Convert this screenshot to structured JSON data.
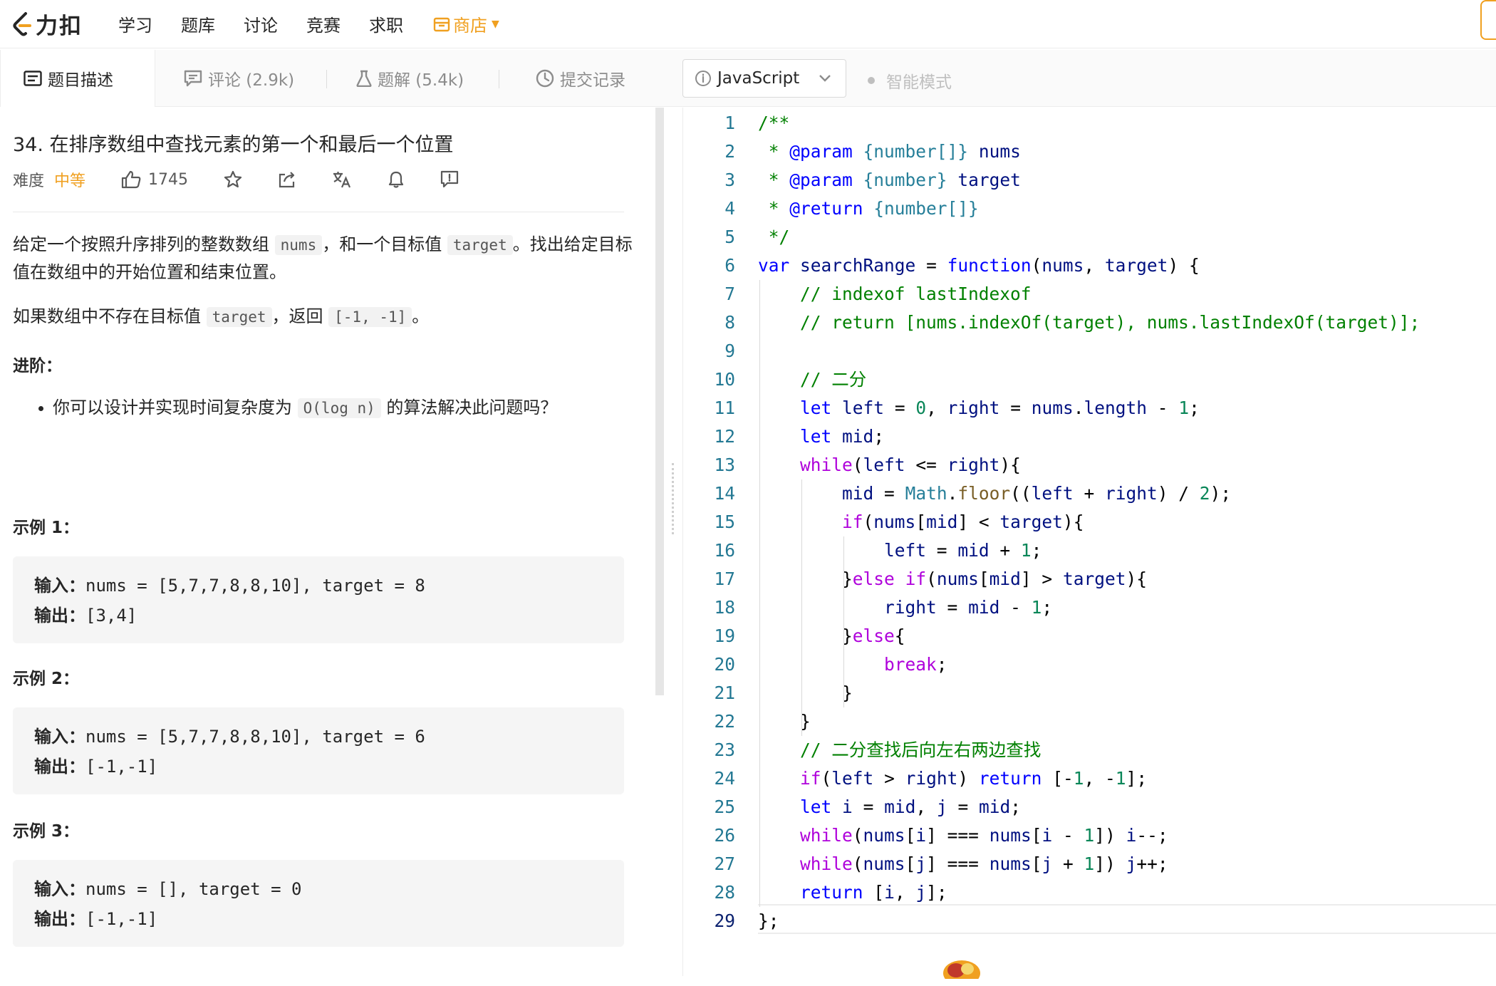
{
  "nav": {
    "logo_text": "力扣",
    "links": [
      "学习",
      "题库",
      "讨论",
      "竞赛",
      "求职"
    ],
    "shop_label": "商店"
  },
  "tabs": {
    "description": "题目描述",
    "comments": "评论 (2.9k)",
    "solutions": "题解 (5.4k)",
    "submissions": "提交记录"
  },
  "editor_toolbar": {
    "language": "JavaScript",
    "smart_mode": "智能模式"
  },
  "problem": {
    "title": "34. 在排序数组中查找元素的第一个和最后一个位置",
    "difficulty_label": "难度",
    "difficulty": "中等",
    "likes": "1745",
    "desc1_a": "给定一个按照升序排列的整数数组 ",
    "desc1_code1": "nums",
    "desc1_b": "，和一个目标值 ",
    "desc1_code2": "target",
    "desc1_c": "。找出给定目标值在数组中的开始位置和结束位置。",
    "desc2_a": "如果数组中不存在目标值 ",
    "desc2_code1": "target",
    "desc2_b": "，返回 ",
    "desc2_code2": "[-1, -1]",
    "desc2_c": "。",
    "advanced_title": "进阶：",
    "advanced_a": "你可以设计并实现时间复杂度为 ",
    "advanced_code": "O(log n)",
    "advanced_b": " 的算法解决此问题吗？",
    "examples": [
      {
        "title": "示例 1：",
        "input_label": "输入：",
        "input": "nums = [5,7,7,8,8,10], target = 8",
        "output_label": "输出：",
        "output": "[3,4]"
      },
      {
        "title": "示例 2：",
        "input_label": "输入：",
        "input": "nums = [5,7,7,8,8,10], target = 6",
        "output_label": "输出：",
        "output": "[-1,-1]"
      },
      {
        "title": "示例 3：",
        "input_label": "输入：",
        "input": "nums = [], target = 0",
        "output_label": "输出：",
        "output": "[-1,-1]"
      }
    ]
  },
  "code_lines": [
    "/**",
    " * @param {number[]} nums",
    " * @param {number} target",
    " * @return {number[]}",
    " */",
    "var searchRange = function(nums, target) {",
    "    // indexof lastIndexof",
    "    // return [nums.indexOf(target), nums.lastIndexOf(target)];",
    "",
    "    // 二分",
    "    let left = 0, right = nums.length - 1;",
    "    let mid;",
    "    while(left <= right){",
    "        mid = Math.floor((left + right) / 2);",
    "        if(nums[mid] < target){",
    "            left = mid + 1;",
    "        }else if(nums[mid] > target){",
    "            right = mid - 1;",
    "        }else{",
    "            break;",
    "        }",
    "    }",
    "    // 二分查找后向左右两边查找",
    "    if(left > right) return [-1, -1];",
    "    let i = mid, j = mid;",
    "    while(nums[i] === nums[i - 1]) i--;",
    "    while(nums[j] === nums[j + 1]) j++;",
    "    return [i, j];",
    "};"
  ]
}
